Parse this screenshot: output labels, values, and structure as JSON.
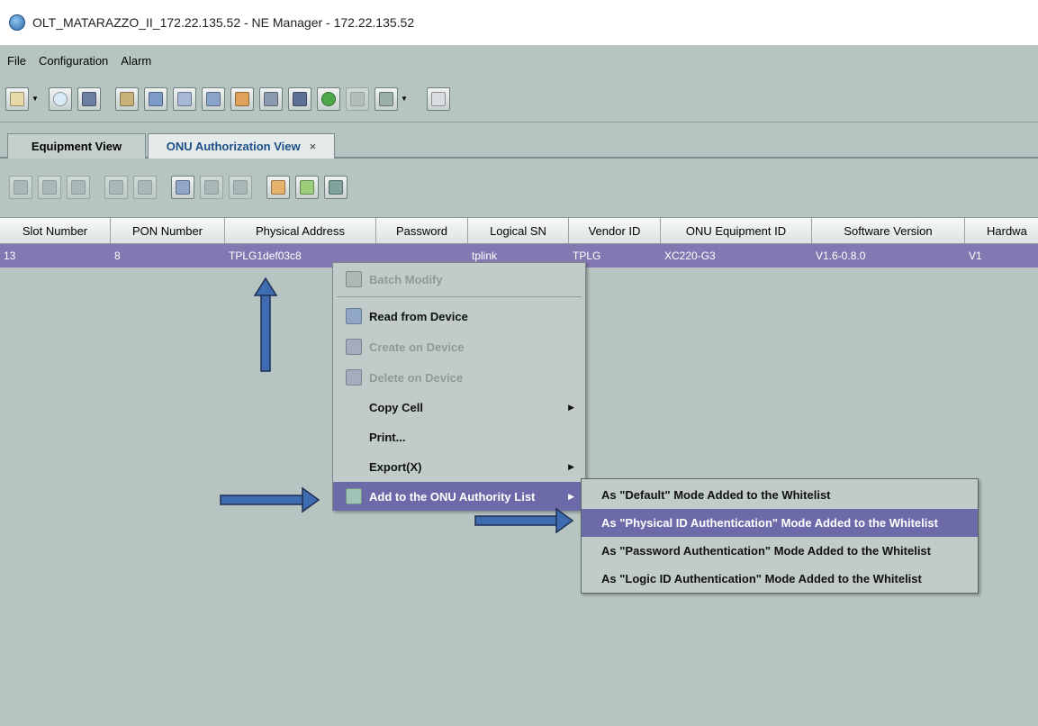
{
  "window": {
    "title": "OLT_MATARAZZO_II_172.22.135.52 - NE Manager - 172.22.135.52",
    "icon": "ne-manager-globe-icon"
  },
  "menubar": {
    "items": [
      "File",
      "Configuration",
      "Alarm"
    ]
  },
  "tabs": {
    "equipment_view": "Equipment View",
    "onu_authorization_view": "ONU Authorization View",
    "close_glyph": "×"
  },
  "table": {
    "columns": [
      "Slot Number",
      "PON Number",
      "Physical Address",
      "Password",
      "Logical SN",
      "Vendor ID",
      "ONU Equipment ID",
      "Software Version",
      "Hardwa"
    ],
    "rows": [
      {
        "slot_number": "13",
        "pon_number": "8",
        "physical_address": "TPLG1def03c8",
        "password": "",
        "logical_sn": "tplink",
        "vendor_id": "TPLG",
        "onu_equipment_id": "XC220-G3",
        "software_version": "V1.6-0.8.0",
        "hardware_version": "V1"
      }
    ]
  },
  "context_menu": {
    "batch_modify": "Batch Modify",
    "read_from_device": "Read from Device",
    "create_on_device": "Create on Device",
    "delete_on_device": "Delete on Device",
    "copy_cell": "Copy Cell",
    "print": "Print...",
    "export": "Export(X)",
    "add_to_onu_authority_list": "Add to the ONU Authority List"
  },
  "submenu": {
    "items": [
      "As \"Default\" Mode Added to the Whitelist",
      "As \"Physical ID Authentication\" Mode Added to the Whitelist",
      "As \"Password Authentication\" Mode Added to the Whitelist",
      "As \"Logic ID Authentication\" Mode Added to the Whitelist"
    ],
    "highlighted_index": 1
  },
  "colors": {
    "background": "#b6c5c2",
    "selected_row": "#8478b2",
    "menu_highlight": "#6c6aa8",
    "annotation_arrow": "#3f6bb0"
  }
}
